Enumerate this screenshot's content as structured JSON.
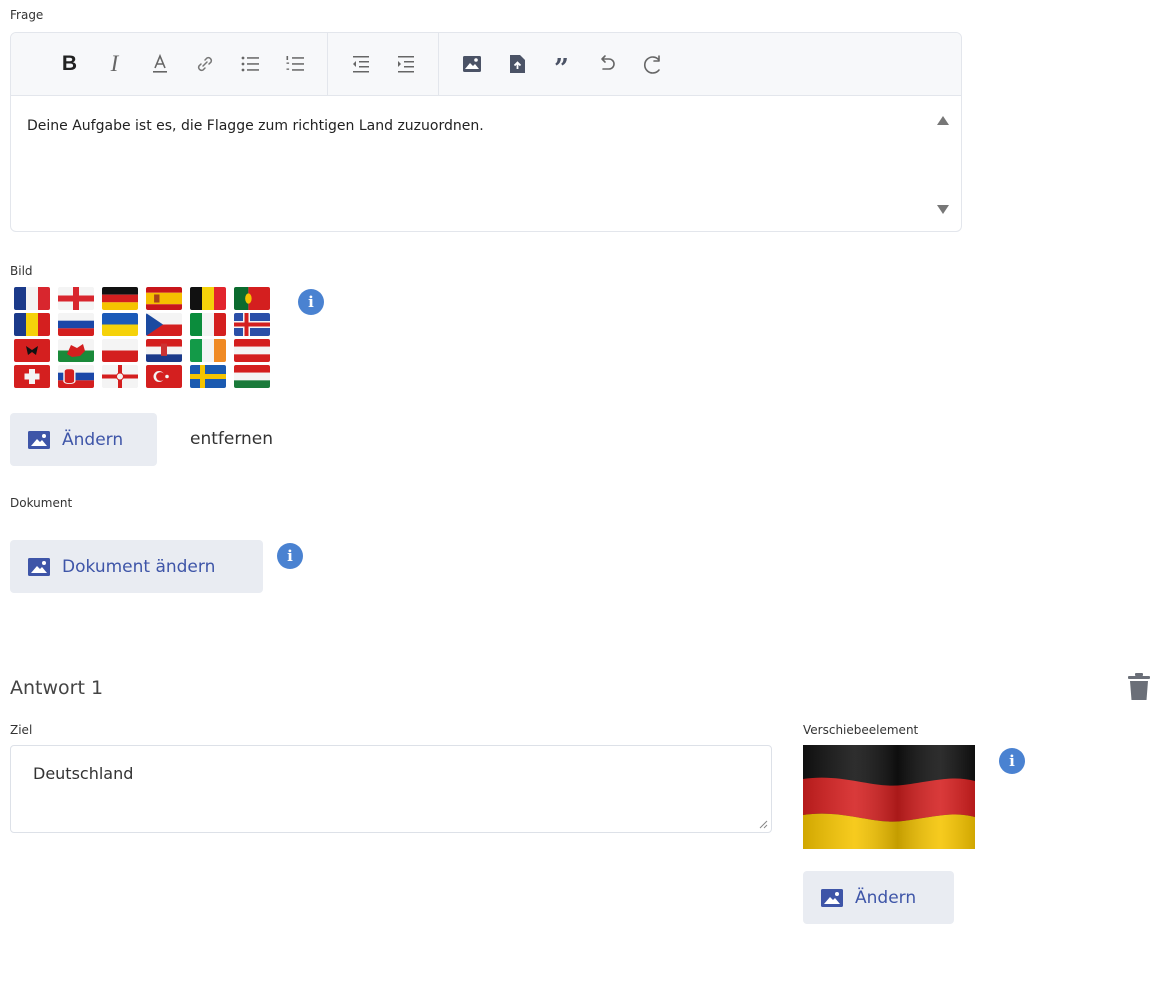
{
  "question": {
    "label": "Frage",
    "text": "Deine Aufgabe ist es, die Flagge zum richtigen Land zuzuordnen.",
    "toolbar": [
      "bold-icon",
      "italic-icon",
      "font-color-icon",
      "link-icon",
      "bullet-list-icon",
      "numbered-list-icon",
      "outdent-icon",
      "indent-icon",
      "image-icon",
      "file-upload-icon",
      "quote-icon",
      "undo-icon",
      "redo-icon"
    ]
  },
  "image": {
    "label": "Bild",
    "change_label": "Ändern",
    "remove_label": "entfernen"
  },
  "document": {
    "label": "Dokument",
    "change_label": "Dokument ändern"
  },
  "answer": {
    "title": "Antwort 1",
    "target_label": "Ziel",
    "target_value": "Deutschland",
    "draggable_label": "Verschiebeelement",
    "change_label": "Ändern"
  },
  "colors": {
    "accent": "#3e55a8",
    "info": "#4a82d1",
    "button_bg": "#e9ecf2"
  }
}
